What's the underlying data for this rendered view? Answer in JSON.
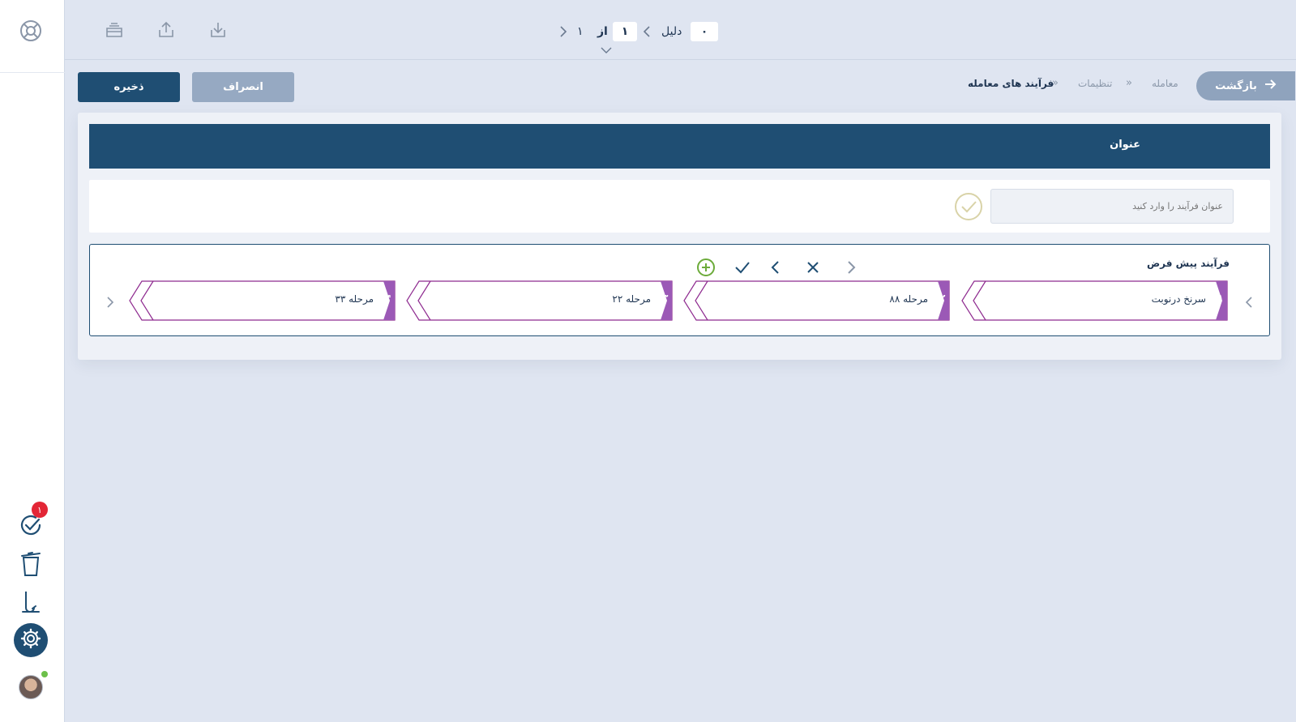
{
  "sidebar": {
    "logo_icon": "lifebuoy-icon",
    "items": [
      {
        "name": "tasks",
        "icon": "check-circle-icon",
        "badge": "۱"
      },
      {
        "name": "trash",
        "icon": "trash-icon"
      },
      {
        "name": "sign",
        "icon": "signature-icon"
      },
      {
        "name": "settings",
        "icon": "gear-icon"
      }
    ],
    "user_status": "online"
  },
  "topbar": {
    "icons": [
      "drawer-icon",
      "upload-icon",
      "download-icon"
    ],
    "pager": {
      "current": "۱",
      "of_label": "از",
      "total": "۱",
      "reason_label": "دلیل",
      "reason_value": "۰"
    }
  },
  "breadcrumb": {
    "back_label": "بازگشت",
    "items": [
      "معامله",
      "تنظیمات",
      "فرآیند های معامله"
    ]
  },
  "actions": {
    "save_label": "ذخیره",
    "cancel_label": "انصراف"
  },
  "form": {
    "header_title": "عنوان",
    "title_placeholder": "عنوان فرآیند را وارد کنید"
  },
  "process": {
    "label": "فرآیند پیش فرض",
    "toolbar": [
      "plus-circle-icon",
      "check-icon",
      "chevron-left-icon",
      "close-icon",
      "chevron-left-icon"
    ],
    "stages": [
      {
        "num": "۱",
        "label": "سرنخ درنوبت"
      },
      {
        "num": "۲",
        "label": "مرحله ۸۸"
      },
      {
        "num": "۳",
        "label": "مرحله ۲۲"
      },
      {
        "num": "۴",
        "label": "مرحله ۳۳"
      }
    ]
  },
  "colors": {
    "primary": "#1f4e73",
    "stage_border": "#8e2a8f",
    "stage_tab": "#9b59b6",
    "badge": "#e32636",
    "accent_green": "#6cc04a"
  }
}
